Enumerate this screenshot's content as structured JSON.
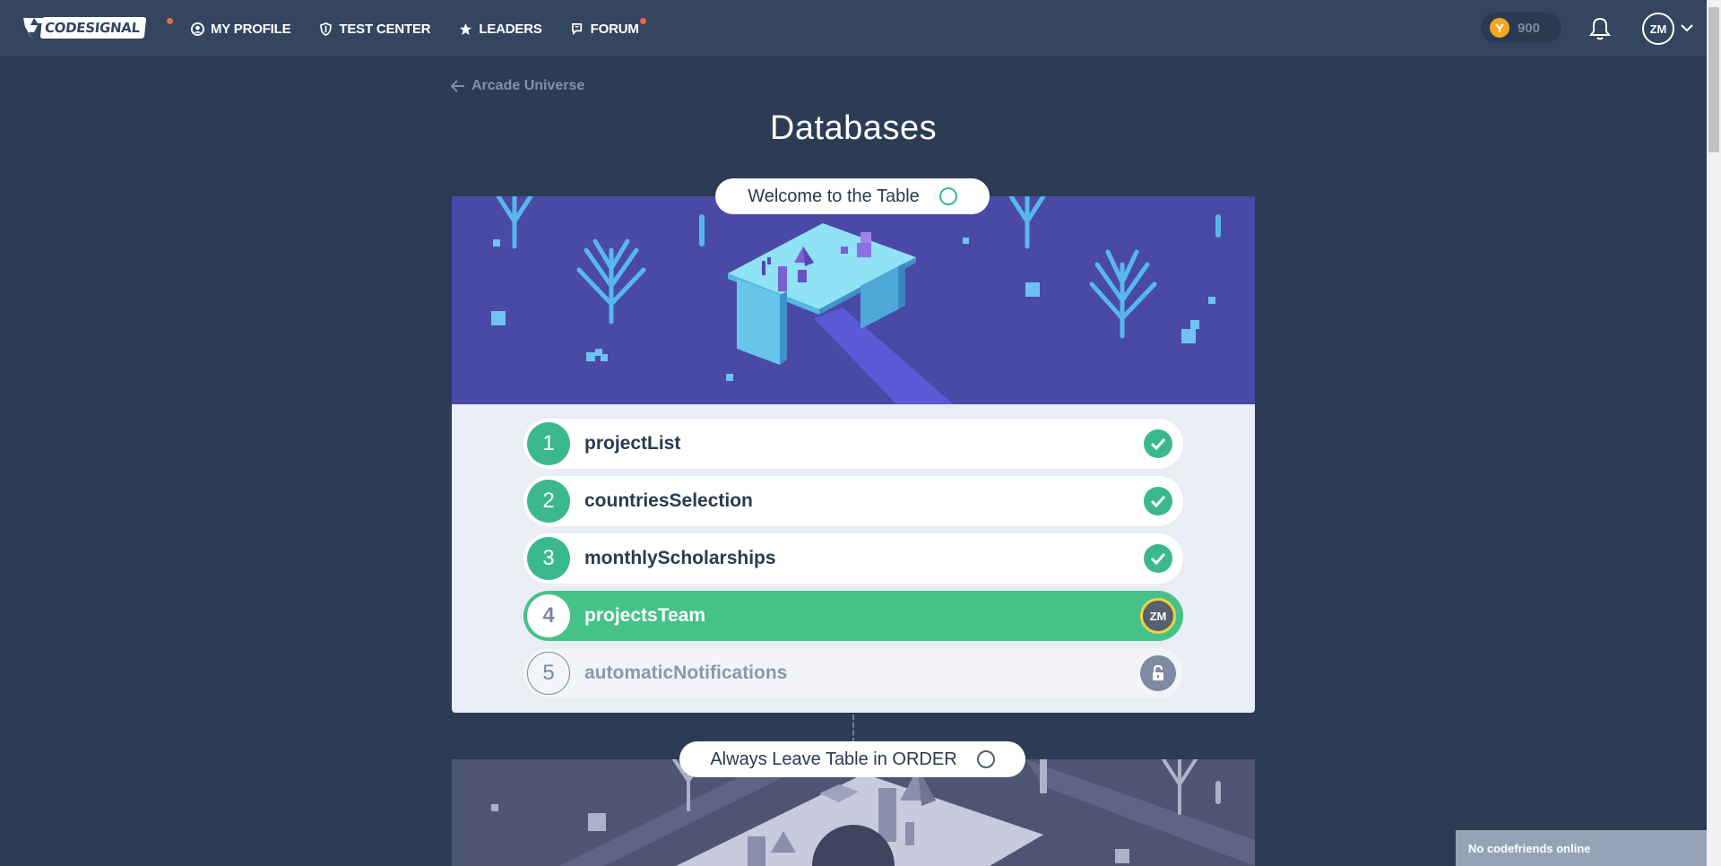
{
  "brand": {
    "logo_text": "CODESIGNAL"
  },
  "nav": {
    "items": [
      {
        "label": "MY PROFILE",
        "icon": "user-circle-icon"
      },
      {
        "label": "TEST CENTER",
        "icon": "shield-icon"
      },
      {
        "label": "LEADERS",
        "icon": "star-icon"
      },
      {
        "label": "FORUM",
        "icon": "chat-icon"
      }
    ]
  },
  "header": {
    "coins": "900",
    "coin_icon": "coin-icon",
    "avatar_initials": "ZM",
    "bell_icon": "bell-icon"
  },
  "breadcrumb": {
    "back_label": "Arcade Universe"
  },
  "page": {
    "title": "Databases"
  },
  "sections": [
    {
      "title": "Welcome to the Table",
      "levels": [
        {
          "number": "1",
          "name": "projectList",
          "state": "completed"
        },
        {
          "number": "2",
          "name": "countriesSelection",
          "state": "completed"
        },
        {
          "number": "3",
          "name": "monthlyScholarships",
          "state": "completed"
        },
        {
          "number": "4",
          "name": "projectsTeam",
          "state": "current",
          "avatar": "ZM"
        },
        {
          "number": "5",
          "name": "automaticNotifications",
          "state": "locked"
        }
      ]
    },
    {
      "title": "Always Leave Table in ORDER"
    }
  ],
  "chat": {
    "status": "No codefriends online"
  },
  "colors": {
    "background": "#2c3c54",
    "topbar": "#33455f",
    "accent_green": "#3bb88f",
    "banner_purple": "#4a49a6",
    "notification_dot": "#f0634b",
    "coin_gold": "#f5a623"
  }
}
